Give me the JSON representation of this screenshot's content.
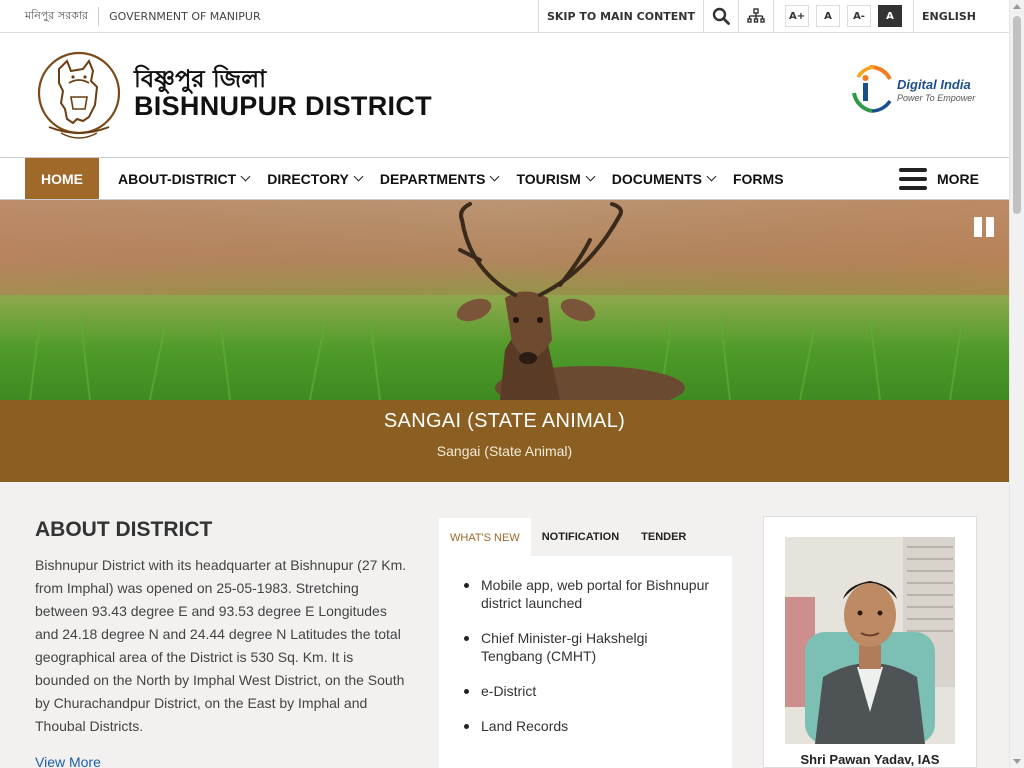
{
  "topbar": {
    "gov_bn": "মনিপুর সরকার",
    "gov_en": "GOVERNMENT OF MANIPUR",
    "skip": "SKIP TO MAIN CONTENT",
    "font_buttons": [
      "A+",
      "A",
      "A-",
      "A"
    ],
    "language": "ENGLISH"
  },
  "header": {
    "title_bn": "বিষ্ণুপুর জিলা",
    "title_en": "BISHNUPUR DISTRICT",
    "digital_india_title": "Digital India",
    "digital_india_tagline": "Power To Empower"
  },
  "nav": {
    "items": [
      {
        "label": "HOME"
      },
      {
        "label": "ABOUT-DISTRICT"
      },
      {
        "label": "DIRECTORY"
      },
      {
        "label": "DEPARTMENTS"
      },
      {
        "label": "TOURISM"
      },
      {
        "label": "DOCUMENTS"
      },
      {
        "label": "FORMS"
      }
    ],
    "more": "MORE"
  },
  "banner": {
    "title": "SANGAI (STATE ANIMAL)",
    "subtitle": "Sangai (State Animal)"
  },
  "about": {
    "heading": "ABOUT DISTRICT",
    "text": "Bishnupur District with its headquarter at Bishnupur (27 Km. from Imphal) was opened on 25-05-1983. Stretching between 93.43 degree E and 93.53 degree E Longitudes and 24.18 degree N and 24.44 degree N Latitudes the total geographical area of the District is 530 Sq. Km. It is bounded on the North by Imphal West District, on the South by Churachandpur District, on the East  by Imphal and Thoubal Districts.",
    "view_more": "View More"
  },
  "tabs": {
    "labels": [
      "WHAT'S NEW",
      "NOTIFICATION",
      "TENDER"
    ],
    "news": [
      "Mobile app, web portal for Bishnupur district launched",
      "Chief Minister-gi Hakshelgi Tengbang (CMHT)",
      "e-District",
      "Land Records"
    ]
  },
  "profile": {
    "name": "Shri Pawan Yadav, IAS"
  },
  "colors": {
    "accent": "#a0692a",
    "caption_bg": "#8b5f21",
    "content_bg": "#f2f1ef"
  }
}
